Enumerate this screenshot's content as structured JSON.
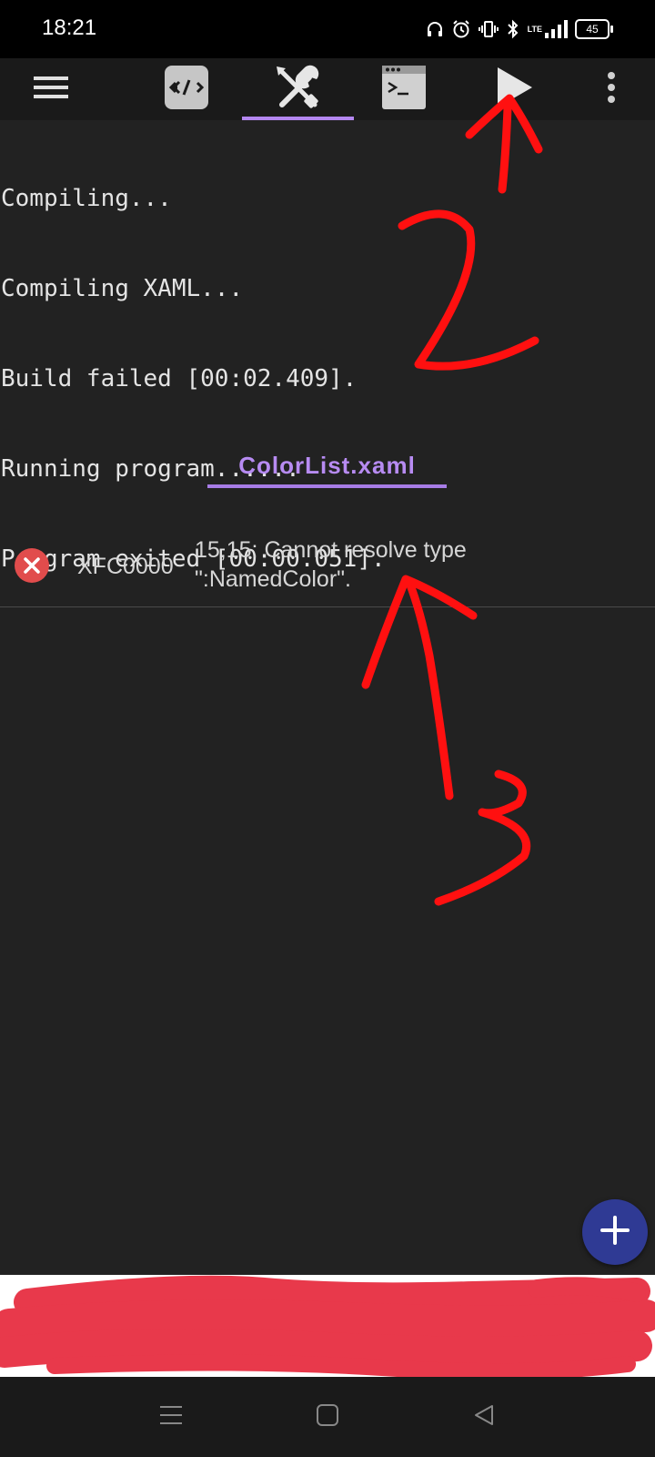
{
  "status_bar": {
    "time": "18:21",
    "network": "LTE",
    "battery": "45",
    "icons": [
      "headset-icon",
      "alarm-icon",
      "vibrate-icon",
      "bluetooth-icon",
      "signal-icon",
      "battery-icon"
    ]
  },
  "toolbar": {
    "tabs": [
      {
        "name": "code-tab",
        "icon": "code-icon"
      },
      {
        "name": "build-tab",
        "icon": "tools-icon",
        "active": true
      },
      {
        "name": "terminal-tab",
        "icon": "terminal-icon"
      }
    ],
    "actions": [
      "menu-icon",
      "play-icon",
      "more-vert-icon"
    ]
  },
  "console": {
    "lines": [
      "Compiling...",
      "Compiling XAML...",
      "Build failed [00:02.409].",
      "Running program......",
      "Program exited [00:00.051]."
    ]
  },
  "errors": {
    "file_tab": "ColorList.xaml",
    "items": [
      {
        "code": "XFC0000",
        "message": "15,15: Cannot resolve type \":NamedColor\"."
      }
    ]
  },
  "annotations": {
    "labels": [
      "2",
      "3"
    ],
    "color": "#ff1010"
  },
  "colors": {
    "accent": "#b487f0",
    "error": "#e14c4c",
    "fab": "#2f3a94",
    "background": "#222222"
  }
}
